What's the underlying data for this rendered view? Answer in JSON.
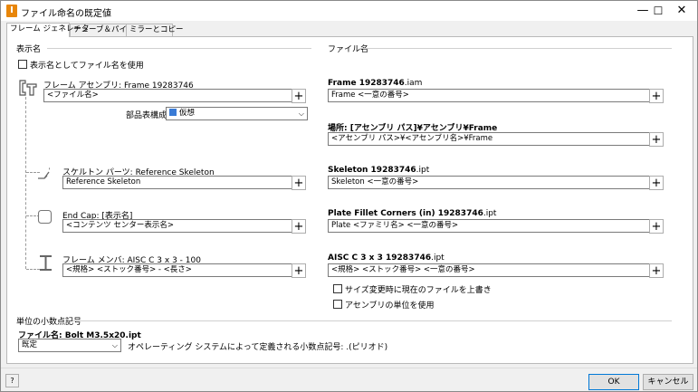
{
  "window": {
    "title": "ファイル命名の既定値",
    "minimize": "—",
    "maximize": "☐",
    "close": "✕"
  },
  "tabs": [
    "フレーム ジェネレータ",
    "チューブ＆パイプ",
    "ミラーとコピー"
  ],
  "display_name": {
    "heading": "表示名",
    "use_filename_label": "表示名としてファイル名を使用",
    "use_filename_checked": false,
    "frame_assembly_label": "フレーム アセンブリ: Frame 19283746",
    "frame_assembly_value": "<ファイル名>",
    "bom_label": "部品表構成",
    "bom_value": "仮想",
    "skeleton_label": "スケルトン パーツ: Reference Skeleton",
    "skeleton_value": "Reference Skeleton",
    "endcap_label": "End Cap: [表示名]",
    "endcap_value": "<コンテンツ センター表示名>",
    "member_label": "フレーム メンバ: AISC C 3 x 3 - 100",
    "member_value": "<規格> <ストック番号> - <長さ>"
  },
  "file_name": {
    "heading": "ファイル名",
    "frame_assembly_label": "Frame 19283746",
    "frame_assembly_ext": ".iam",
    "frame_assembly_value": "Frame <一意の番号>",
    "location_label": "場所: [アセンブリ パス]¥アセンブリ¥Frame",
    "location_value": "<アセンブリ パス>¥<アセンブリ名>¥Frame",
    "skeleton_label": "Skeleton 19283746",
    "skeleton_ext": ".ipt",
    "skeleton_value": "Skeleton <一意の番号>",
    "endcap_label": "Plate Fillet Corners (in) 19283746",
    "endcap_ext": ".ipt",
    "endcap_value": "Plate <ファミリ名> <一意の番号>",
    "member_label": "AISC C 3 x 3 19283746",
    "member_ext": ".ipt",
    "member_value": "<規格> <ストック番号> <一意の番号>",
    "overwrite_label": "サイズ変更時に現在のファイルを上書き",
    "overwrite_checked": false,
    "assembly_units_label": "アセンブリの単位を使用",
    "assembly_units_checked": false
  },
  "decimal": {
    "heading": "単位の小数点記号",
    "file_name_label": "ファイル名: Bolt M3.5x20.ipt",
    "select_value": "既定",
    "note": "オペレーティング システムによって定義される小数点記号: .(ピリオド)"
  },
  "buttons": {
    "plus": "+",
    "help": "?",
    "ok": "OK",
    "cancel": "キャンセル"
  }
}
